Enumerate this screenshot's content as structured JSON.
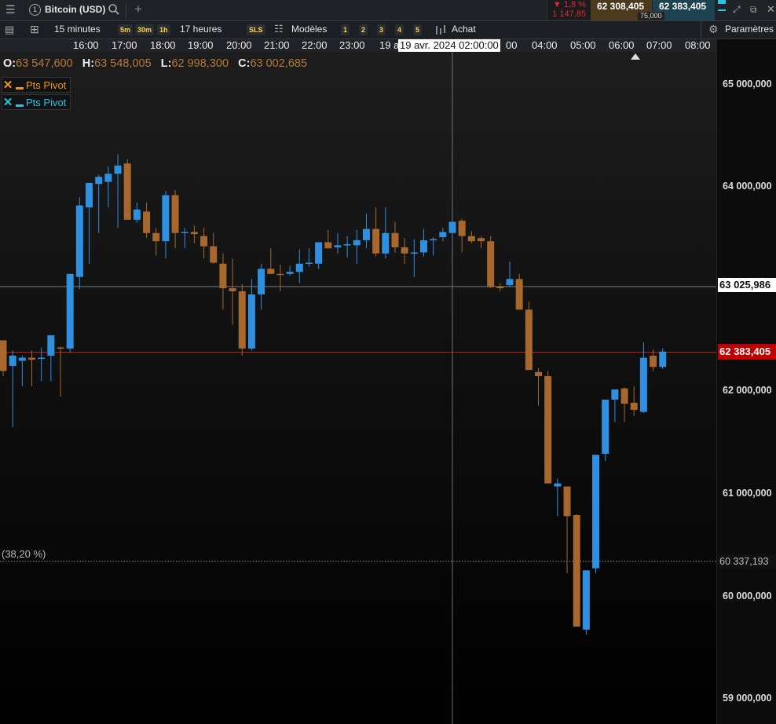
{
  "header": {
    "tab_number": "1",
    "tab_title": "Bitcoin (USD)",
    "change_pct": "▼ 1,8 %",
    "change_abs": "1 147,85",
    "bid": "62 308,405",
    "ask": "62 383,405",
    "spread": "75,000"
  },
  "toolbar": {
    "timeframe": "15 minutes",
    "quick_5m": "5m",
    "quick_30m": "30m",
    "quick_1h": "1h",
    "range": "17 heures",
    "sls": "SLS",
    "templates": "Modèles",
    "layouts": [
      "1",
      "2",
      "3",
      "4",
      "5"
    ],
    "buy": "Achat",
    "settings": "Paramètres"
  },
  "time_axis": {
    "labels": [
      "16:00",
      "17:00",
      "18:00",
      "19:00",
      "20:00",
      "21:00",
      "22:00",
      "23:00",
      "19 a",
      "00",
      "04:00",
      "05:00",
      "06:00",
      "07:00",
      "08:00"
    ],
    "crosshair_label": "19 avr. 2024 02:00:00"
  },
  "ohlc": {
    "o_label": "O:",
    "o": "63 547,600",
    "h_label": "H:",
    "h": "63 548,005",
    "l_label": "L:",
    "l": "62 998,300",
    "c_label": "C:",
    "c": "63 002,685"
  },
  "legend": [
    {
      "close": "✕",
      "label": "Pts Pivot",
      "color": "#f0961e"
    },
    {
      "close": "✕",
      "label": "Pts Pivot",
      "color": "#2bc4e0"
    }
  ],
  "price_axis": {
    "labels": [
      "65 000,000",
      "64 000,000",
      "62 000,000",
      "61 000,000",
      "60 000,000",
      "59 000,000"
    ],
    "crosshair_price": "63 025,986",
    "last_price": "62 383,405",
    "fib_price": "60 337,193",
    "fib_label": "(38,20 %)"
  },
  "colors": {
    "up": "#2f8fe0",
    "down": "#a8672c",
    "last_line": "#c0201a",
    "last_bg": "#c00000"
  },
  "chart_data": {
    "type": "candlestick",
    "timeframe": "15 minutes",
    "ylim": [
      58950,
      65250
    ],
    "crosshair": {
      "time": "19 avr. 2024 02:00:00",
      "price": 63025.986
    },
    "last_price": 62383.405,
    "fib_38_2": 60337.193,
    "candles": [
      [
        62500,
        62500,
        62150,
        62200
      ],
      [
        62250,
        62400,
        61650,
        62350
      ],
      [
        62300,
        62350,
        62050,
        62330
      ],
      [
        62330,
        62400,
        62050,
        62310
      ],
      [
        62320,
        62430,
        62100,
        62330
      ],
      [
        62350,
        62500,
        62100,
        62550
      ],
      [
        62430,
        62440,
        61950,
        62420
      ],
      [
        62420,
        63120,
        62380,
        63150
      ],
      [
        63120,
        63900,
        63000,
        63820
      ],
      [
        63800,
        64000,
        63250,
        64040
      ],
      [
        64030,
        64120,
        63550,
        64100
      ],
      [
        64050,
        64200,
        63800,
        64130
      ],
      [
        64130,
        64320,
        63600,
        64210
      ],
      [
        64230,
        64270,
        63700,
        63680
      ],
      [
        63680,
        63850,
        63650,
        63780
      ],
      [
        63760,
        63850,
        63500,
        63550
      ],
      [
        63550,
        63600,
        63330,
        63470
      ],
      [
        63470,
        63960,
        63300,
        63920
      ],
      [
        63920,
        63970,
        63400,
        63550
      ],
      [
        63550,
        63600,
        63400,
        63560
      ],
      [
        63560,
        63620,
        63450,
        63540
      ],
      [
        63520,
        63600,
        63300,
        63420
      ],
      [
        63420,
        63550,
        63250,
        63260
      ],
      [
        63250,
        63350,
        62800,
        63010
      ],
      [
        63010,
        63300,
        62650,
        62980
      ],
      [
        62980,
        63050,
        62350,
        62420
      ],
      [
        62420,
        63100,
        62400,
        62950
      ],
      [
        62950,
        63250,
        62800,
        63200
      ],
      [
        63200,
        63400,
        63150,
        63150
      ],
      [
        63150,
        63240,
        62980,
        63140
      ],
      [
        63150,
        63230,
        63130,
        63170
      ],
      [
        63170,
        63390,
        63060,
        63250
      ],
      [
        63250,
        63400,
        63220,
        63260
      ],
      [
        63250,
        63450,
        63200,
        63460
      ],
      [
        63460,
        63580,
        63400,
        63400
      ],
      [
        63410,
        63550,
        63350,
        63430
      ],
      [
        63430,
        63520,
        63310,
        63440
      ],
      [
        63430,
        63580,
        63250,
        63480
      ],
      [
        63480,
        63740,
        63400,
        63590
      ],
      [
        63590,
        63800,
        63320,
        63350
      ],
      [
        63350,
        63800,
        63300,
        63550
      ],
      [
        63550,
        63660,
        63360,
        63410
      ],
      [
        63410,
        63500,
        63250,
        63350
      ],
      [
        63360,
        63490,
        63120,
        63360
      ],
      [
        63360,
        63590,
        63320,
        63480
      ],
      [
        63480,
        63510,
        63330,
        63490
      ],
      [
        63510,
        63600,
        63470,
        63560
      ],
      [
        63550,
        63650,
        63500,
        63660
      ],
      [
        63670,
        63690,
        63360,
        63520
      ],
      [
        63520,
        63570,
        63450,
        63470
      ],
      [
        63500,
        63520,
        63400,
        63470
      ],
      [
        63470,
        63520,
        63010,
        63020
      ],
      [
        63030,
        63060,
        62980,
        63010
      ],
      [
        63040,
        63270,
        63020,
        63100
      ],
      [
        63100,
        63150,
        62820,
        62800
      ],
      [
        62800,
        62880,
        62600,
        62210
      ],
      [
        62190,
        62230,
        61860,
        62150
      ],
      [
        62150,
        62200,
        61180,
        61100
      ],
      [
        61070,
        61150,
        60780,
        61100
      ],
      [
        61070,
        61060,
        60220,
        60780
      ],
      [
        60790,
        60800,
        59700,
        59700
      ],
      [
        59670,
        59770,
        59620,
        60250
      ],
      [
        60270,
        60290,
        60220,
        61380
      ],
      [
        61390,
        61480,
        61320,
        61920
      ],
      [
        61920,
        61950,
        61700,
        62020
      ],
      [
        62030,
        62040,
        61700,
        61880
      ],
      [
        61890,
        62050,
        61760,
        61820
      ],
      [
        61800,
        62480,
        61790,
        62330
      ],
      [
        62350,
        62410,
        62200,
        62240
      ],
      [
        62240,
        62420,
        62220,
        62390
      ]
    ]
  }
}
